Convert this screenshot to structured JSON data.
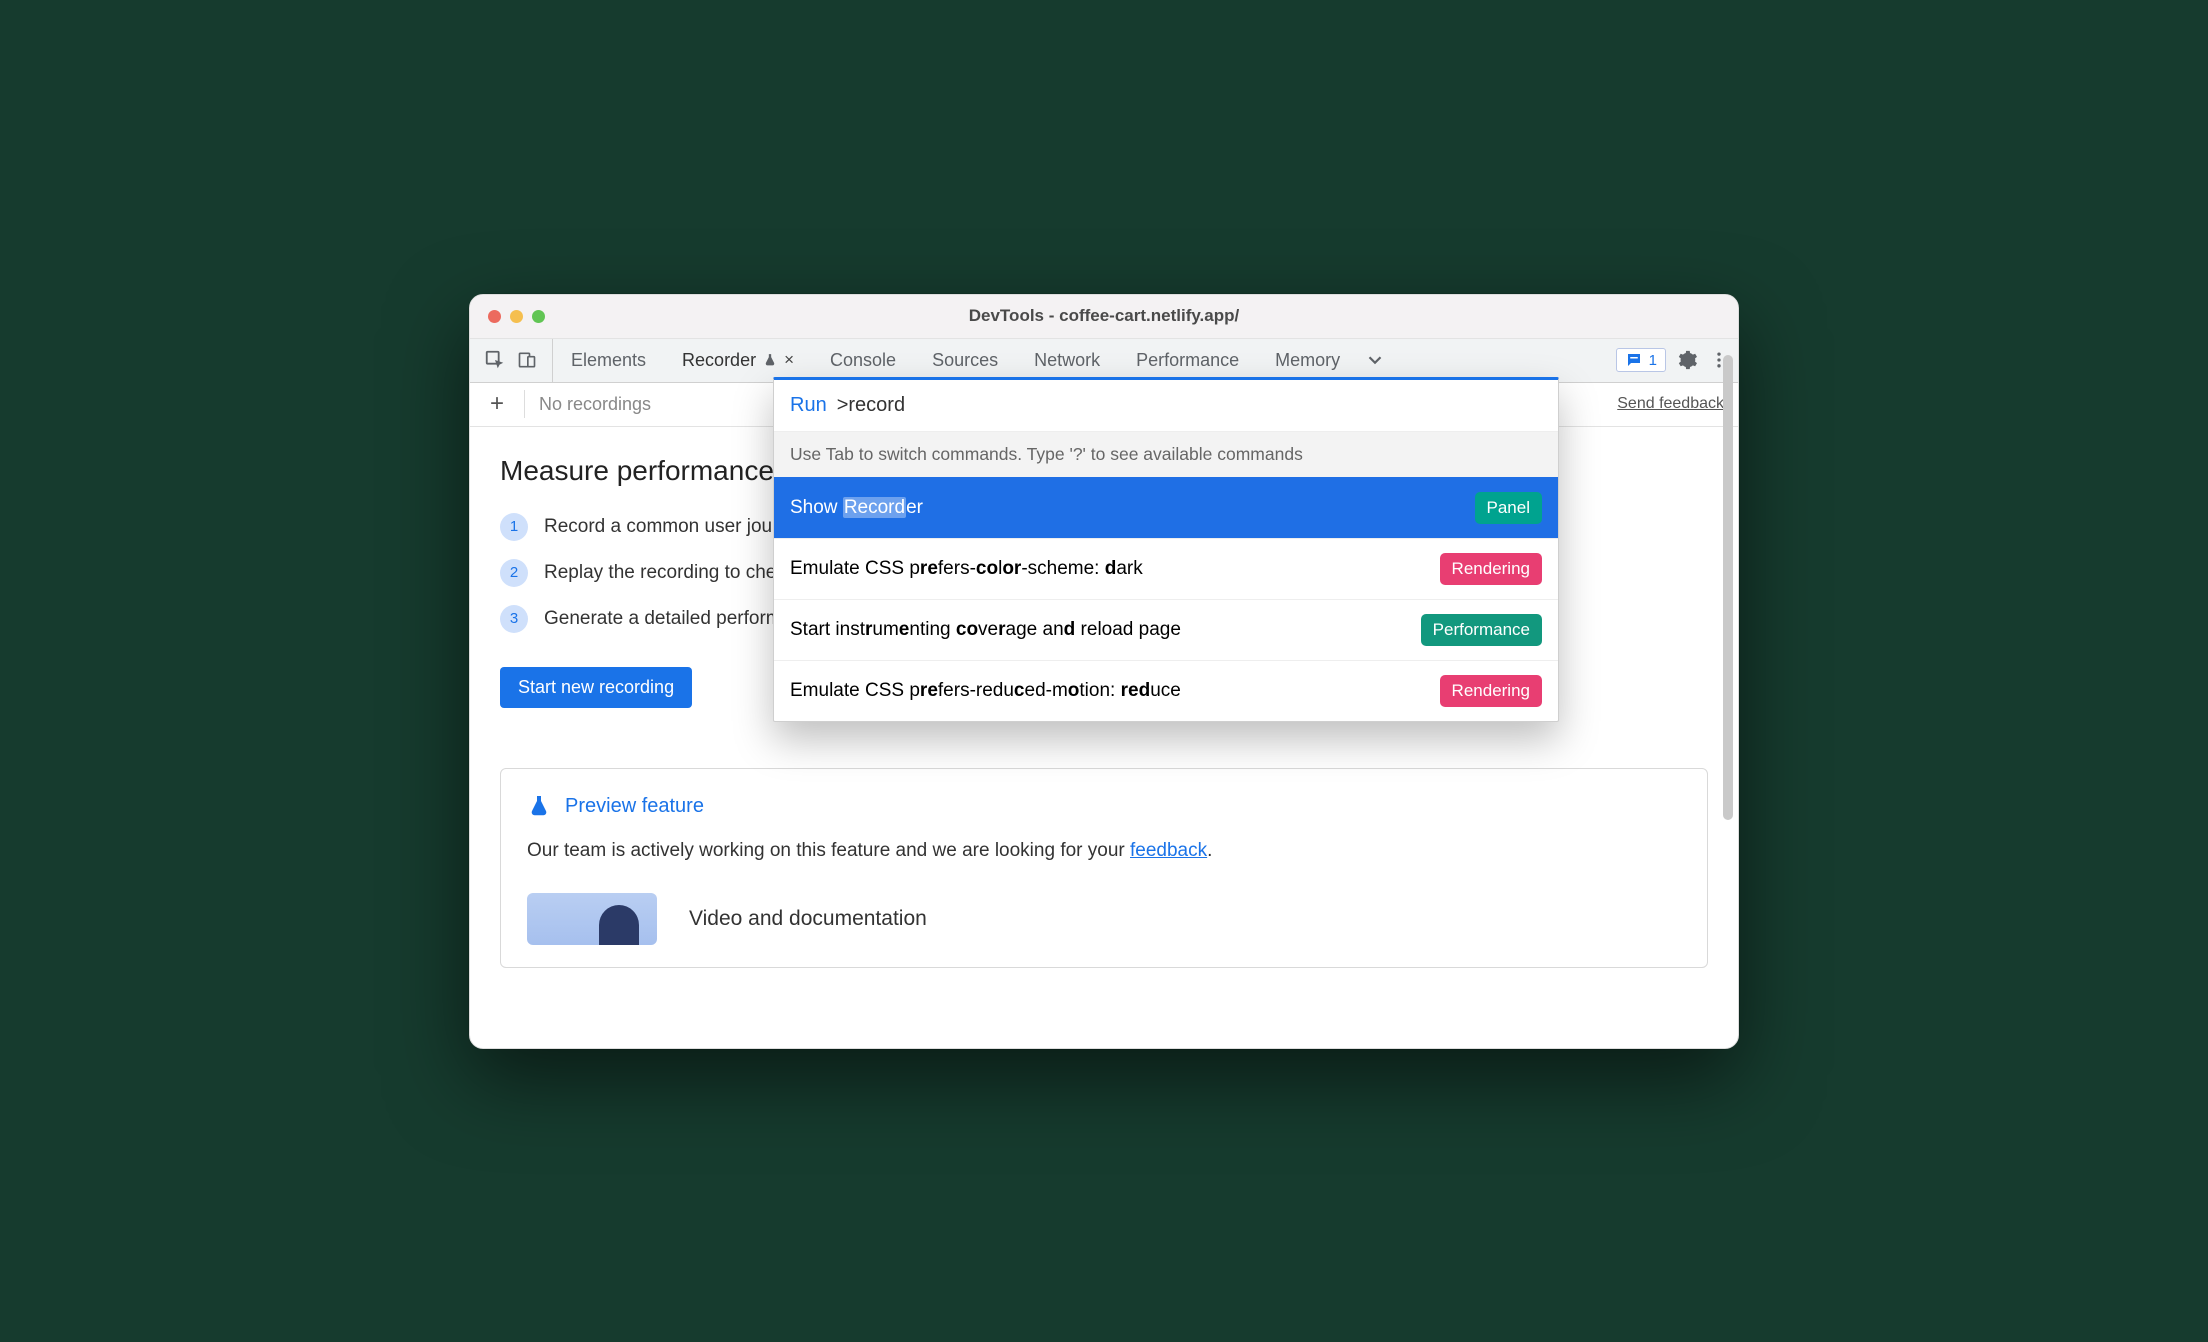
{
  "window": {
    "title": "DevTools - coffee-cart.netlify.app/"
  },
  "tabs": {
    "items": [
      "Elements",
      "Recorder",
      "Console",
      "Sources",
      "Network",
      "Performance",
      "Memory"
    ],
    "activeIndex": 1
  },
  "issues": {
    "count": "1"
  },
  "subbar": {
    "placeholder": "No recordings",
    "feedback": "Send feedback"
  },
  "page": {
    "heading": "Measure performance across an entire user journey",
    "steps": [
      "Record a common user journey on your website or app",
      "Replay the recording to check it works",
      "Generate a detailed performance trace"
    ],
    "start_button": "Start new recording",
    "preview": {
      "title": "Preview feature",
      "body_prefix": "Our team is actively working on this feature and we are looking for your ",
      "link": "feedback",
      "body_suffix": ".",
      "video_title": "Video and documentation"
    }
  },
  "command_menu": {
    "run_label": "Run",
    "prefix": ">",
    "query": "record",
    "hint": "Use Tab to switch commands. Type '?' to see available commands",
    "items": [
      {
        "label_html": "Show <span class='hl'>Record</span>er",
        "badge": "Panel",
        "badge_kind": "panel",
        "selected": true
      },
      {
        "label_html": "Emulate CSS p<span class='b'>r</span><span class='b'>e</span>fers-<span class='b'>c</span><span class='b'>o</span>l<span class='b'>o</span><span class='b'>r</span>-scheme: <span class='b'>d</span>ark",
        "badge": "Rendering",
        "badge_kind": "render",
        "selected": false
      },
      {
        "label_html": "Start inst<span class='b'>r</span>um<span class='b'>e</span>nting <span class='b'>c</span><span class='b'>o</span>ve<span class='b'>r</span>age an<span class='b'>d</span> reload page",
        "badge": "Performance",
        "badge_kind": "perf",
        "selected": false
      },
      {
        "label_html": "Emulate CSS p<span class='b'>r</span><span class='b'>e</span>fers-redu<span class='b'>c</span>ed-m<span class='b'>o</span>tion: <span class='b'>r</span><span class='b'>e</span><span class='b'>d</span>uce",
        "badge": "Rendering",
        "badge_kind": "render",
        "selected": false
      }
    ]
  }
}
